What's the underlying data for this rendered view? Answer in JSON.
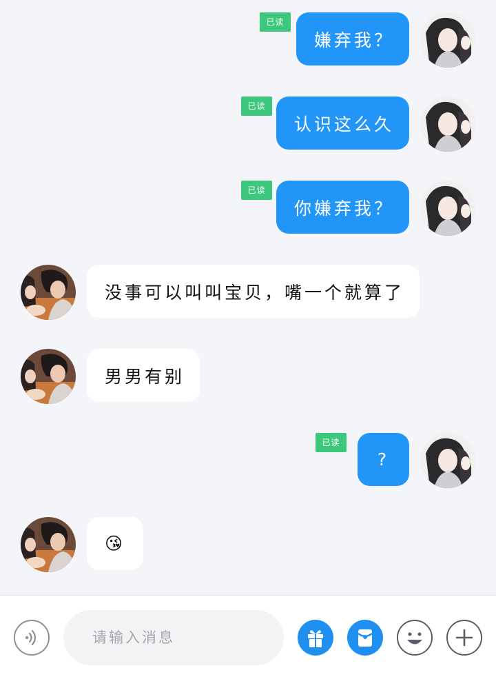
{
  "messages": [
    {
      "side": "out",
      "text": "嫌弃我？",
      "read": "已读"
    },
    {
      "side": "out",
      "text": "认识这么久",
      "read": "已读"
    },
    {
      "side": "out",
      "text": "你嫌弃我？",
      "read": "已读"
    },
    {
      "side": "in",
      "text": "没事可以叫叫宝贝，嘴一个就算了"
    },
    {
      "side": "in",
      "text": "男男有别"
    },
    {
      "side": "out",
      "text": "?",
      "read": "已读"
    },
    {
      "side": "in",
      "text": "😘"
    }
  ],
  "composer": {
    "placeholder": "请输入消息",
    "icons": [
      "voice-icon",
      "gift-icon",
      "red-packet-icon",
      "emoji-icon",
      "plus-icon"
    ]
  },
  "colors": {
    "outgoing_bubble": "#2196f8",
    "incoming_bubble": "#ffffff",
    "read_badge": "#3cc77c",
    "background": "#f4f5f8"
  }
}
